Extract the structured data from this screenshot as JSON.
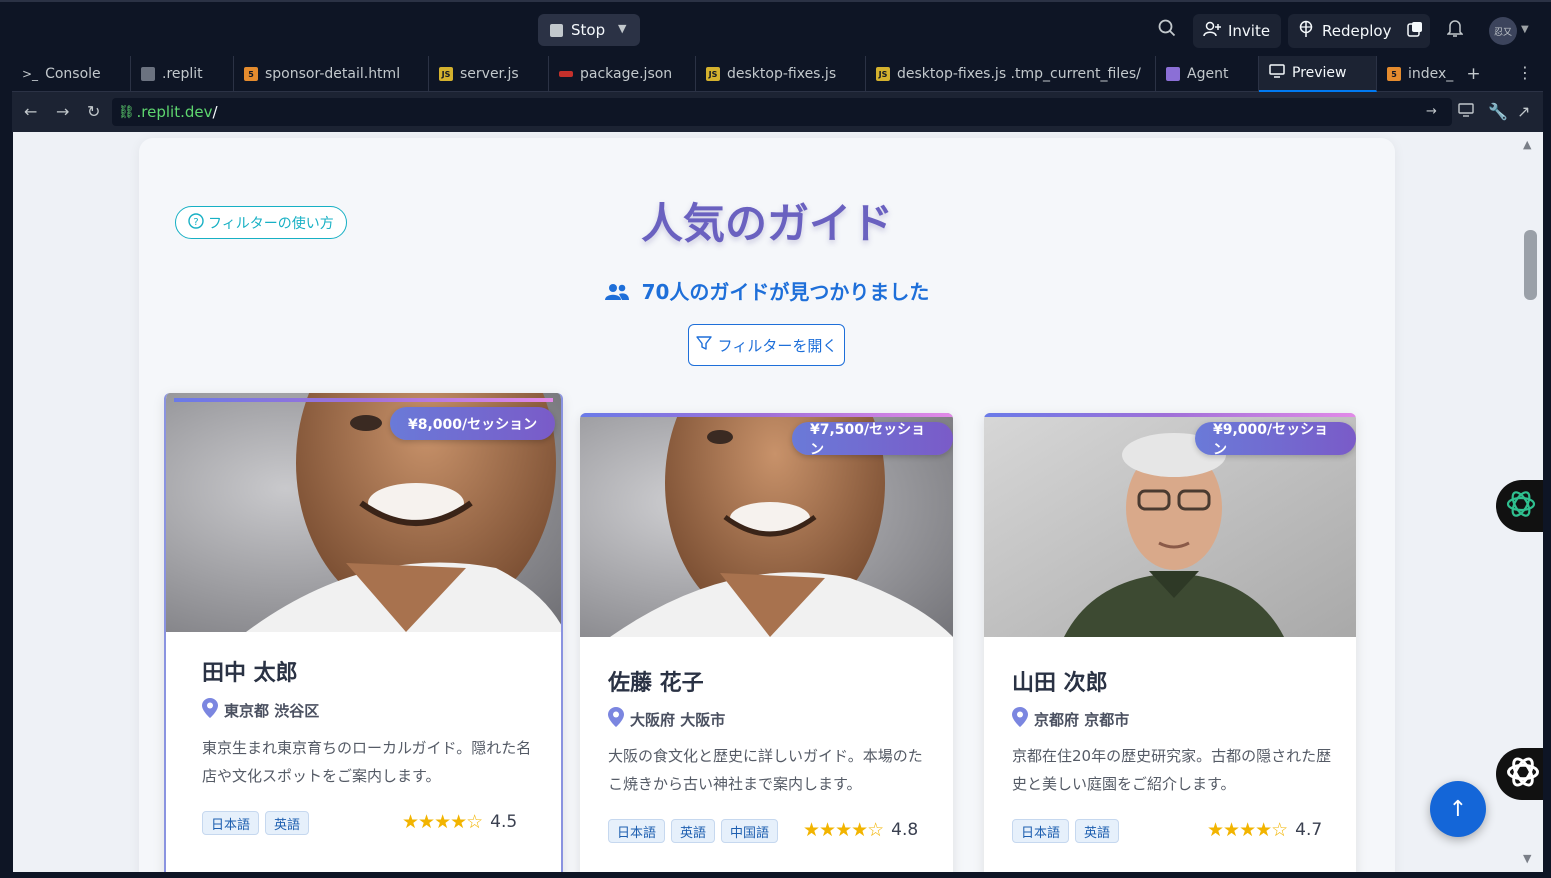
{
  "topbar": {
    "stop_label": "Stop",
    "invite_label": "Invite",
    "redeploy_label": "Redeploy",
    "avatar_text": "忍又"
  },
  "tabs": [
    {
      "label": "Console",
      "icon": "terminal-icon"
    },
    {
      "label": ".replit",
      "icon": "replit-icon"
    },
    {
      "label": "sponsor-detail.html",
      "icon": "html5-icon"
    },
    {
      "label": "server.js",
      "icon": "js-icon"
    },
    {
      "label": "package.json",
      "icon": "npm-icon"
    },
    {
      "label": "desktop-fixes.js",
      "icon": "js-icon"
    },
    {
      "label": "desktop-fixes.js .tmp_current_files/",
      "icon": "js-icon"
    },
    {
      "label": "Agent",
      "icon": "agent-icon"
    },
    {
      "label": "Preview",
      "icon": "monitor-icon"
    },
    {
      "label": "index_",
      "icon": "html5-icon"
    }
  ],
  "url": {
    "domain": ".replit.dev",
    "path": "/"
  },
  "page": {
    "help_label": "フィルターの使い方",
    "title": "人気のガイド",
    "count_text": "70人のガイドが見つかりました",
    "filter_button": "フィルターを開く"
  },
  "guides": [
    {
      "price": "¥8,000/セッション",
      "name": "田中 太郎",
      "location": "東京都 渋谷区",
      "description": "東京生まれ東京育ちのローカルガイド。隠れた名店や文化スポットをご案内します。",
      "languages": [
        "日本語",
        "英語"
      ],
      "stars": "★★★★☆",
      "rating": "4.5"
    },
    {
      "price": "¥7,500/セッション",
      "name": "佐藤 花子",
      "location": "大阪府 大阪市",
      "description": "大阪の食文化と歴史に詳しいガイド。本場のたこ焼きから古い神社まで案内します。",
      "languages": [
        "日本語",
        "英語",
        "中国語"
      ],
      "stars": "★★★★☆",
      "rating": "4.8"
    },
    {
      "price": "¥9,000/セッション",
      "name": "山田 次郎",
      "location": "京都府 京都市",
      "description": "京都在住20年の歴史研究家。古都の隠された歴史と美しい庭園をご紹介します。",
      "languages": [
        "日本語",
        "英語"
      ],
      "stars": "★★★★☆",
      "rating": "4.7"
    }
  ],
  "colors": {
    "accent": "#1e6fd9",
    "title": "#6a61c0",
    "star": "#f2b400"
  }
}
